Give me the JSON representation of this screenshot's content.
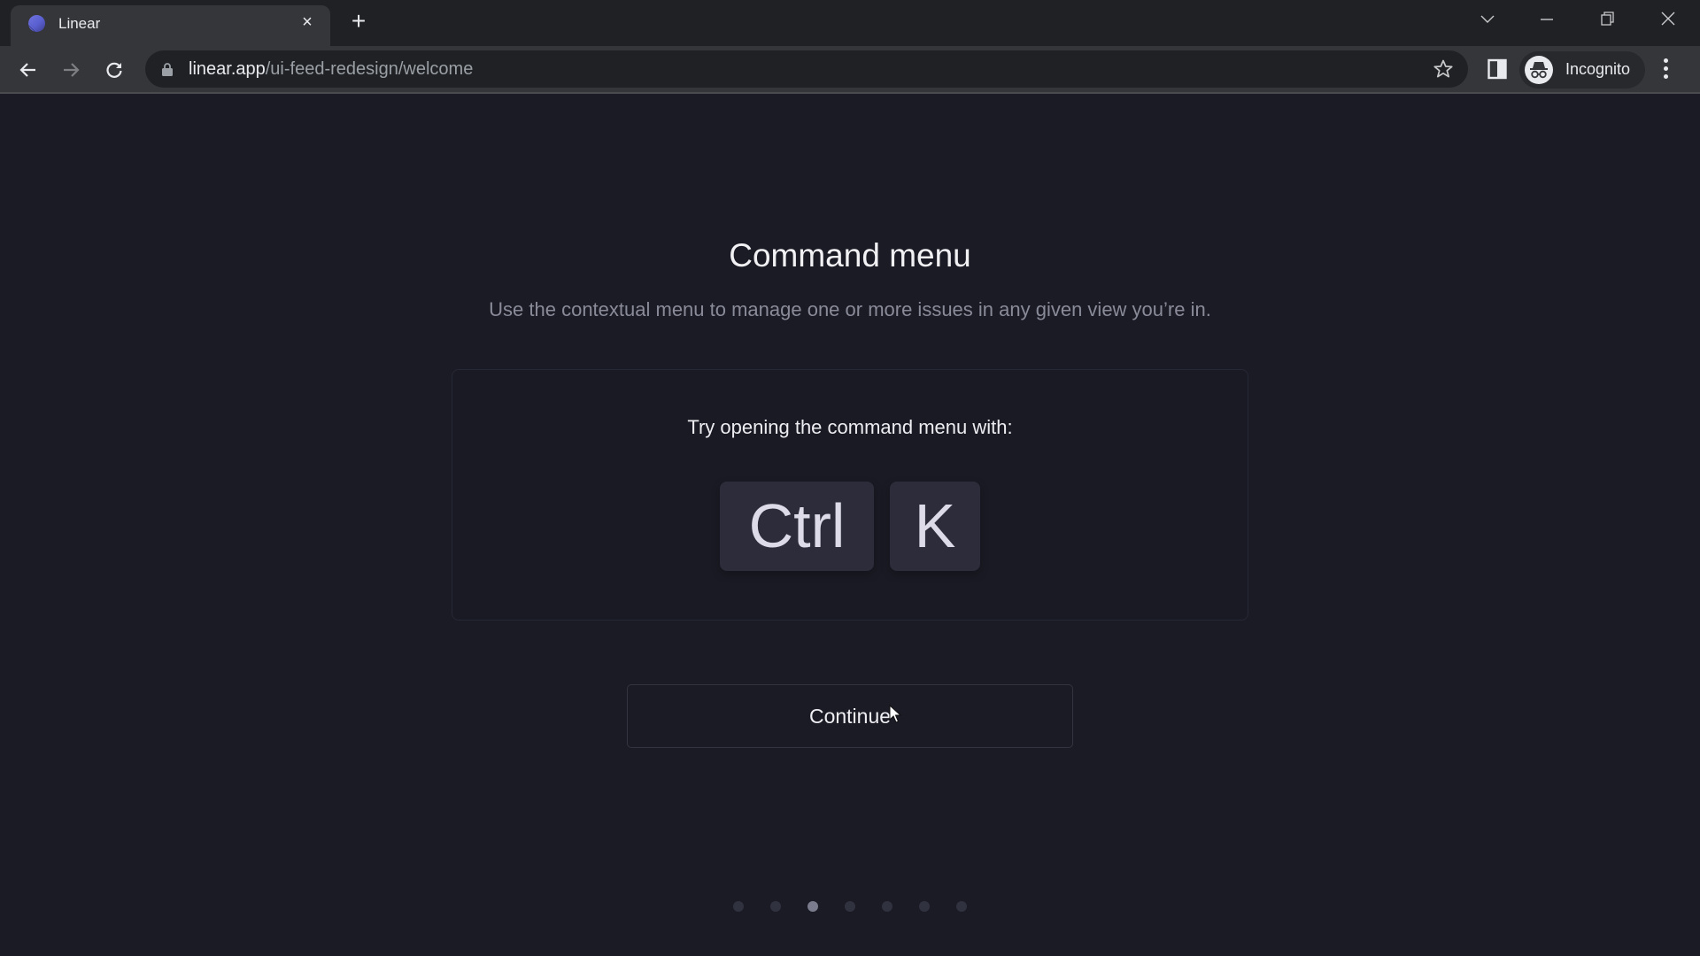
{
  "browser": {
    "tab": {
      "title": "Linear",
      "favicon": "linear-logo-icon",
      "close_icon": "×"
    },
    "new_tab_icon": "+",
    "window_controls": [
      "tab-search",
      "minimize",
      "restore",
      "close"
    ],
    "url": {
      "host": "linear.app",
      "path": "/ui-feed-redesign/welcome"
    },
    "profile_label": "Incognito"
  },
  "page": {
    "title": "Command menu",
    "subtitle": "Use the contextual menu to manage one or more issues in any given view you’re in.",
    "card": {
      "prompt": "Try opening the command menu with:",
      "keys": [
        "Ctrl",
        "K"
      ]
    },
    "continue_label": "Continue",
    "pagination": {
      "total": 7,
      "active_index": 2
    }
  },
  "colors": {
    "background": "#1b1b25",
    "key_bg": "#2c2c3b",
    "dot_active": "#7a7b8c",
    "dot_inactive": "#31323f"
  }
}
